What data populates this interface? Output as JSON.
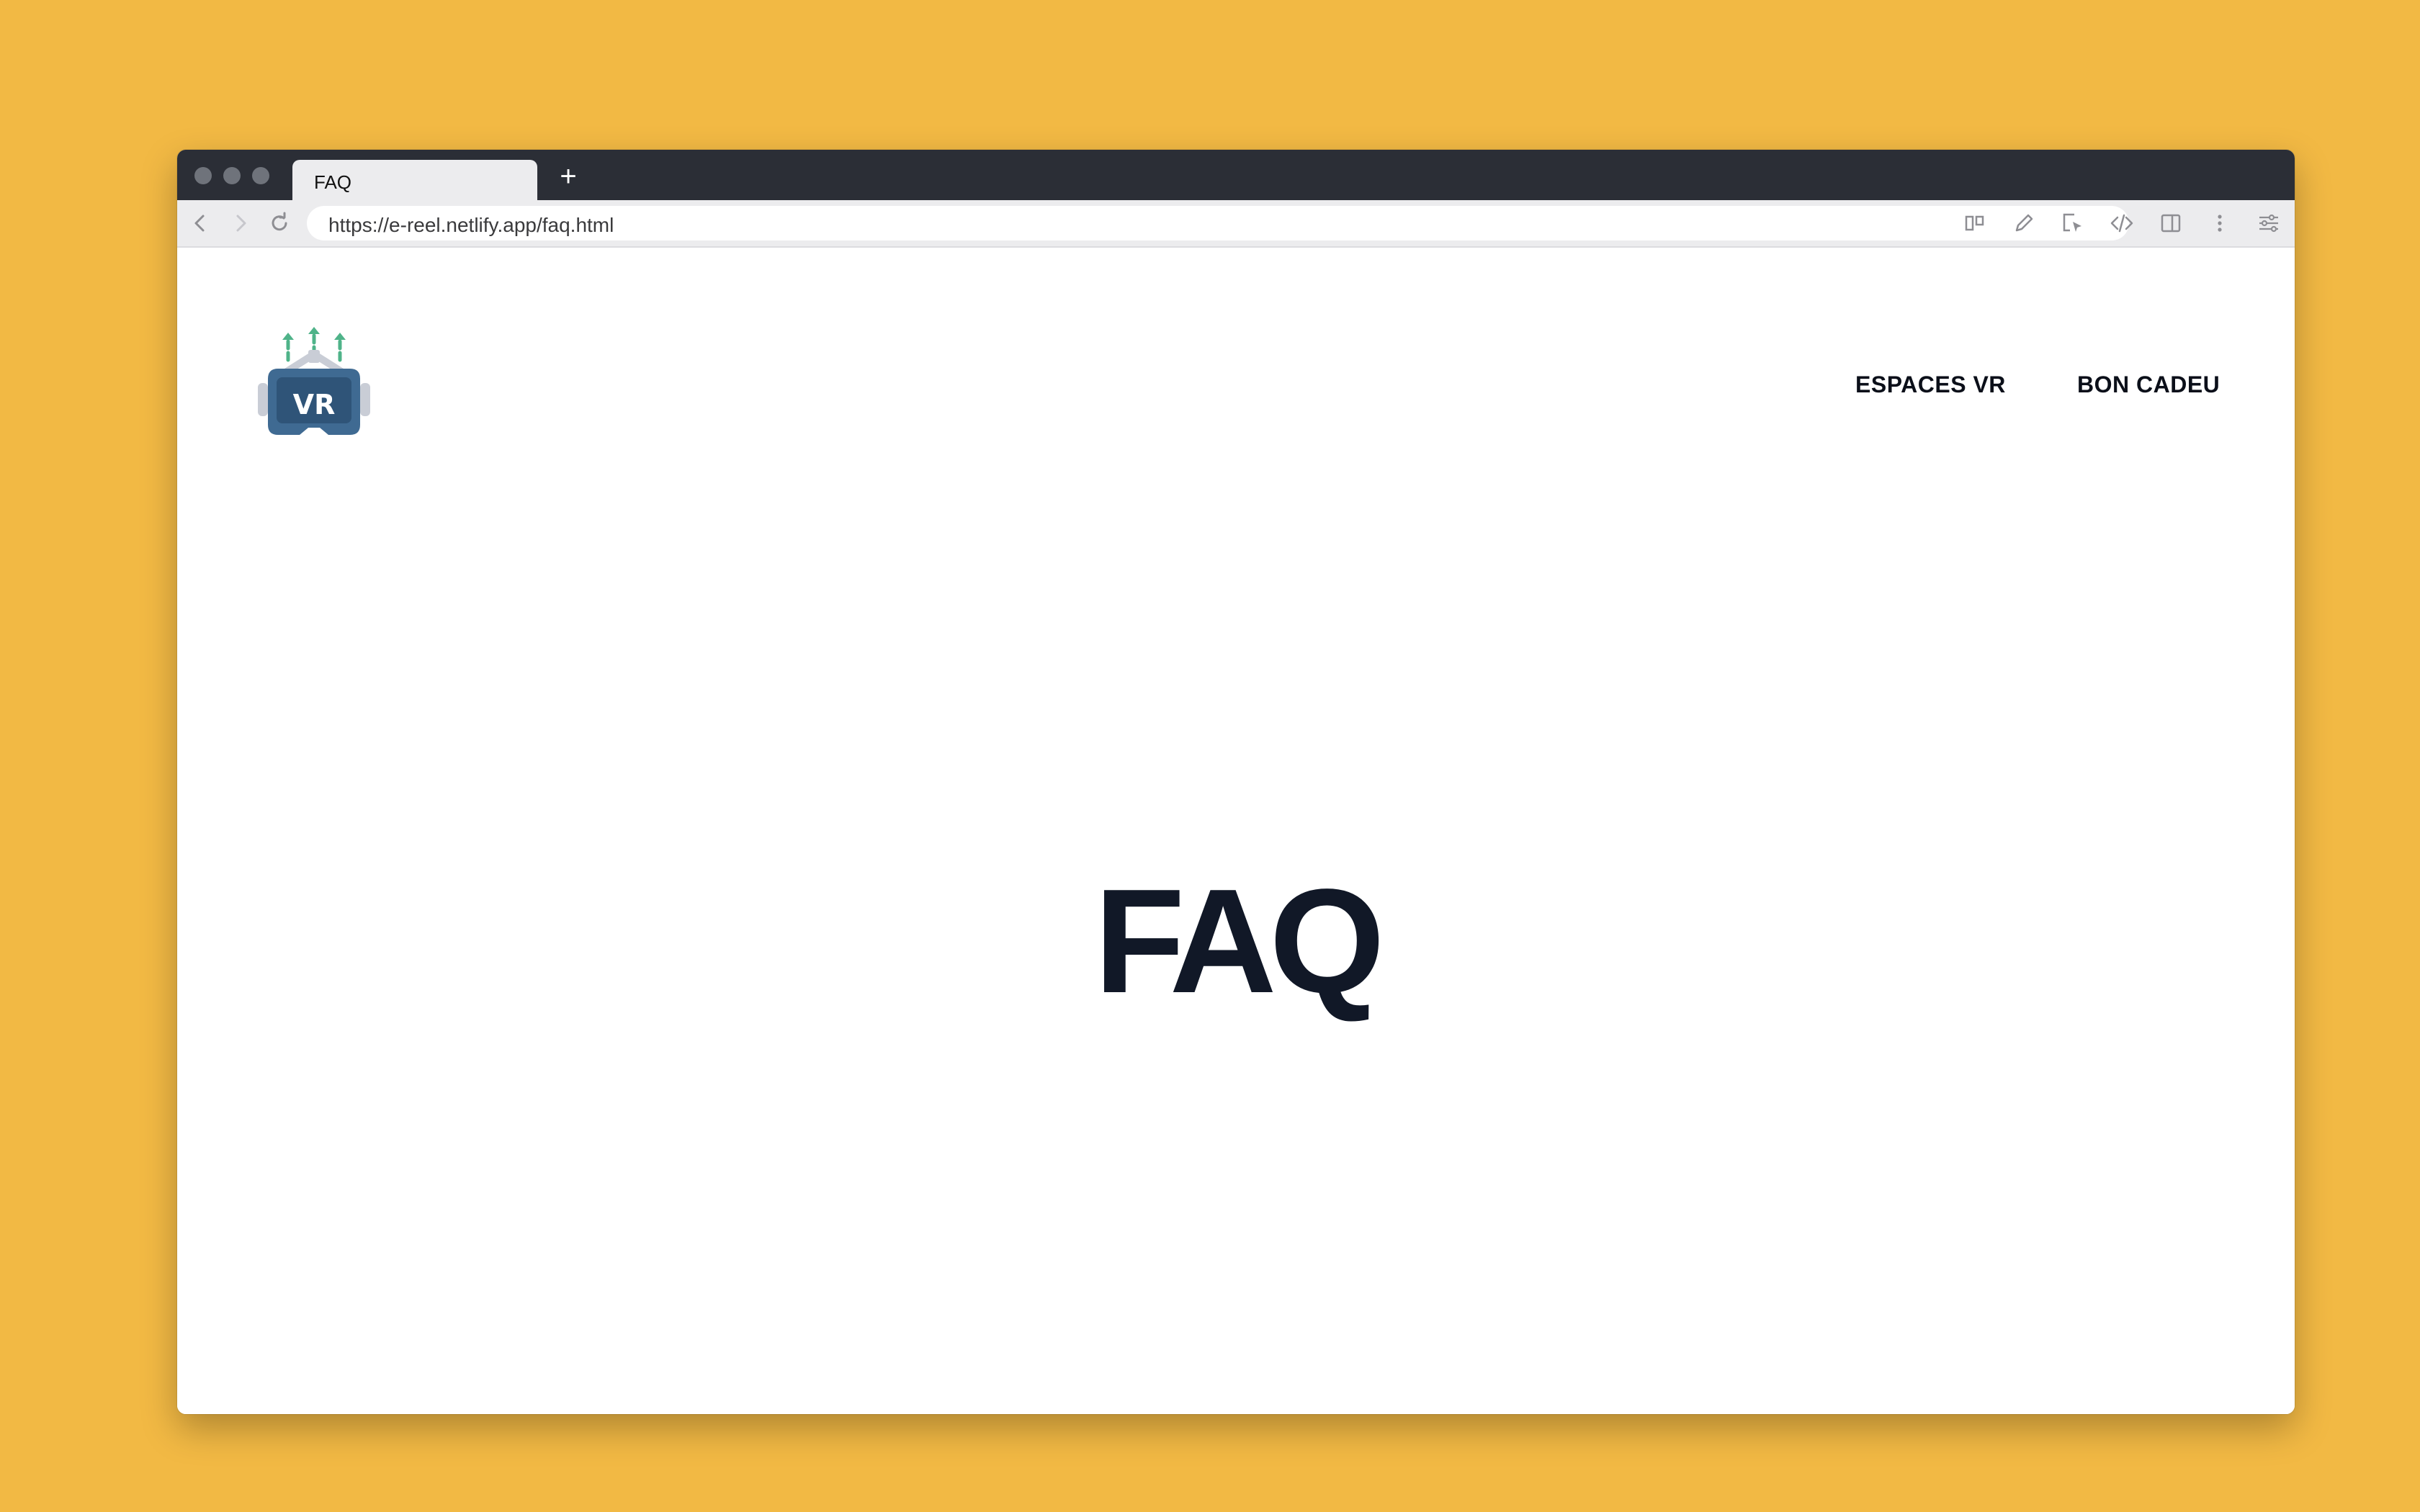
{
  "browser": {
    "tab_title": "FAQ",
    "new_tab_label": "+",
    "url": "https://e-reel.netlify.app/faq.html",
    "toolbar_icons": [
      "columns-icon",
      "pencil-icon",
      "cursor-select-icon",
      "code-icon",
      "sidebar-icon",
      "more-vertical-icon",
      "sliders-icon"
    ]
  },
  "site": {
    "logo_text": "VR",
    "nav": {
      "espaces_vr": "ESPACES VR",
      "bon_cadeau": "BON CADEU"
    },
    "hero_title": "FAQ"
  },
  "colors": {
    "background": "#F2B944",
    "titlebar": "#2B2E36",
    "headset_blue": "#3F6A92",
    "arrow_green": "#4FB389",
    "text_dark": "#111827"
  }
}
